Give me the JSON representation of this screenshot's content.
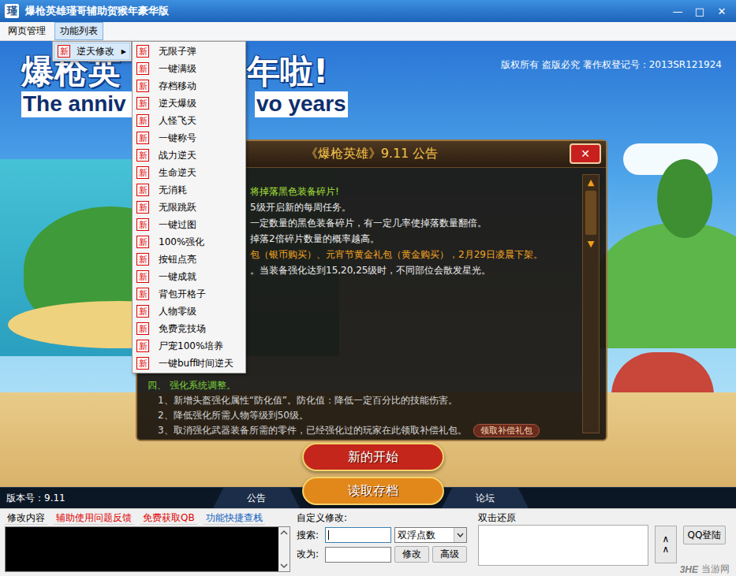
{
  "window": {
    "icon": "瑾",
    "title": "爆枪英雄瑾哥辅助贺猴年豪华版",
    "controls": [
      "—",
      "□",
      "✕"
    ]
  },
  "menubar": [
    {
      "label": "网页管理",
      "selected": false
    },
    {
      "label": "功能列表",
      "selected": true
    }
  ],
  "dropdown": {
    "items": [
      {
        "badge": "新",
        "label": "逆天修改",
        "arrow": "▶",
        "selected": true
      }
    ]
  },
  "submenu": {
    "items": [
      {
        "badge": "新",
        "label": "无限子弹"
      },
      {
        "badge": "新",
        "label": "一键满级"
      },
      {
        "badge": "新",
        "label": "存档移动"
      },
      {
        "badge": "新",
        "label": "逆天爆级"
      },
      {
        "badge": "新",
        "label": "人怪飞天"
      },
      {
        "badge": "新",
        "label": "一键称号"
      },
      {
        "badge": "新",
        "label": "战力逆天"
      },
      {
        "badge": "新",
        "label": "生命逆天"
      },
      {
        "badge": "新",
        "label": "无消耗"
      },
      {
        "badge": "新",
        "label": "无限跳跃"
      },
      {
        "badge": "新",
        "label": "一键过图"
      },
      {
        "badge": "新",
        "label": "100%强化"
      },
      {
        "badge": "新",
        "label": "按钮点亮"
      },
      {
        "badge": "新",
        "label": "一键成就"
      },
      {
        "badge": "新",
        "label": "背包开格子"
      },
      {
        "badge": "新",
        "label": "人物零级"
      },
      {
        "badge": "新",
        "label": "免费竞技场"
      },
      {
        "badge": "新",
        "label": "尸宠100%培养"
      },
      {
        "badge": "新",
        "label": "一键buff时间逆天"
      }
    ]
  },
  "game": {
    "banner": {
      "title_left": "爆枪英",
      "title_right": "年啦!",
      "subtitle_left": "The anniv",
      "subtitle_right": "vo years"
    },
    "copyright": "版权所有 盗版必究 著作权登记号：2013SR121924",
    "announcement": {
      "title": "《爆枪英雄》9.11 公告",
      "close": "✕",
      "scroll_up": "▲",
      "scroll_down": "▼",
      "notes": [
        {
          "text": "将掉落黑色装备碎片!",
          "color": "#a6e03c"
        },
        {
          "text": "5级开启新的每周任务。",
          "color": "#ececec"
        },
        {
          "text": "一定数量的黑色装备碎片，有一定几率使掉落数量翻倍。",
          "color": "#ececec"
        },
        {
          "text": "掉落2倍碎片数量的概率越高。",
          "color": "#ececec"
        },
        {
          "text": "包（银币购买）、元宵节黄金礼包（黄金购买），2月29日凌晨下架。",
          "color": "#f5a623"
        },
        {
          "text": "。当装备强化达到15,20,25级时，不同部位会散发星光。",
          "color": "#ececec"
        }
      ],
      "section": {
        "heading": "四、 强化系统调整。",
        "items": [
          "1、新增头盔强化属性“防化值”。防化值：降低一定百分比的技能伤害。",
          "2、降低强化所需人物等级到50级。",
          "3、取消强化武器装备所需的零件，已经强化过的玩家在此领取补偿礼包。"
        ],
        "claim_button": "领取补偿礼包"
      }
    },
    "buttons": [
      {
        "label": "新的开始",
        "color": "#c4261c"
      },
      {
        "label": "读取存档",
        "color": "#e2881a"
      }
    ],
    "version": "版本号：9.11",
    "tabs": [
      "公告",
      "论坛"
    ]
  },
  "panel": {
    "tabs": [
      {
        "label": "修改内容",
        "color": "#000000"
      },
      {
        "label": "辅助使用问题反馈",
        "color": "#e00000"
      },
      {
        "label": "免费获取QB",
        "color": "#e00000"
      },
      {
        "label": "功能快捷查栈",
        "color": "#1060c0"
      }
    ],
    "custom": {
      "title": "自定义修改:",
      "search_label": "搜索:",
      "search_focused": true,
      "type": "双浮点数",
      "replace_label": "改为:",
      "buttons": [
        "修改",
        "高级"
      ]
    },
    "restore_label": "双击还原",
    "collapse_button": "∧∧",
    "login_button": "QQ登陆"
  },
  "watermark": {
    "logo": "3HE",
    "text": "当游网"
  }
}
